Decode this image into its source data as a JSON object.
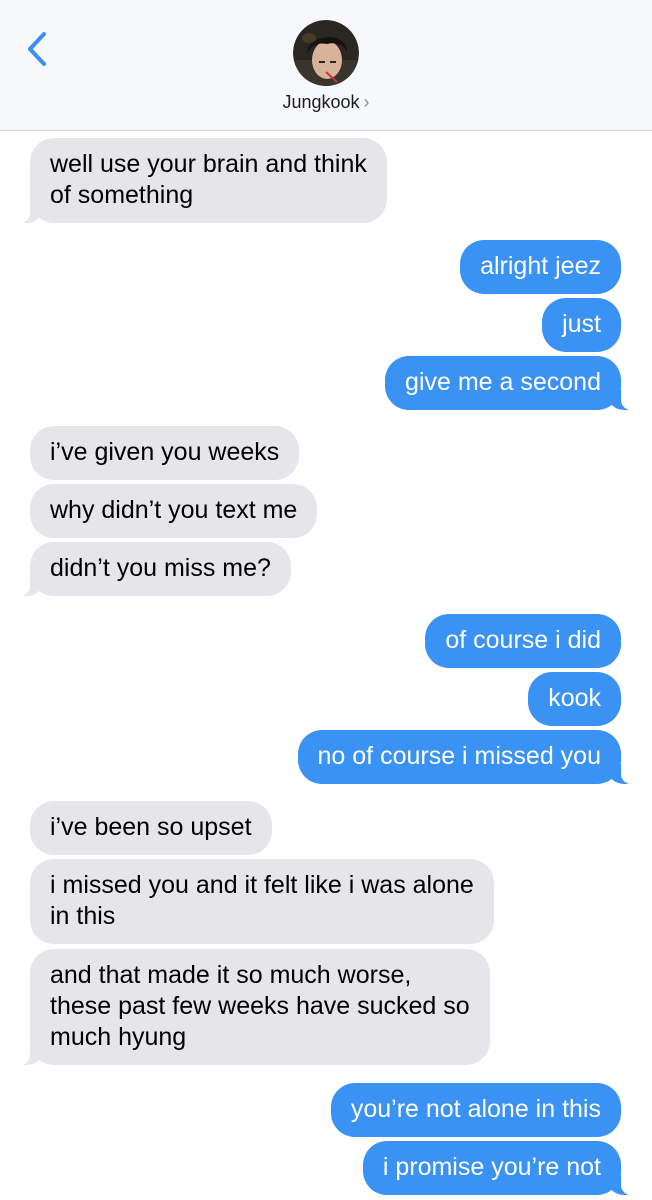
{
  "header": {
    "contact_name": "Jungkook",
    "chevron": "›",
    "back_icon": "chevron-left-icon",
    "accent_color": "#3a92f5"
  },
  "messages": [
    {
      "from": "them",
      "text": "well use your brain and think\nof something"
    },
    {
      "from": "me",
      "text": "alright jeez"
    },
    {
      "from": "me",
      "text": "just"
    },
    {
      "from": "me",
      "text": "give me a second"
    },
    {
      "from": "them",
      "text": "i’ve given you weeks"
    },
    {
      "from": "them",
      "text": "why didn’t you text me"
    },
    {
      "from": "them",
      "text": "didn’t you miss me?"
    },
    {
      "from": "me",
      "text": "of course i did"
    },
    {
      "from": "me",
      "text": "kook"
    },
    {
      "from": "me",
      "text": "no of course i missed you"
    },
    {
      "from": "them",
      "text": "i’ve been so upset"
    },
    {
      "from": "them",
      "text": "i missed you and it felt like i was alone\nin this"
    },
    {
      "from": "them",
      "text": "and that made it so much worse,\nthese past few weeks have sucked so\nmuch hyung"
    },
    {
      "from": "me",
      "text": "you’re not alone in this"
    },
    {
      "from": "me",
      "text": "i promise you’re not"
    }
  ],
  "colors": {
    "incoming_bubble": "#e5e5ea",
    "outgoing_bubble": "#3a92f5"
  }
}
